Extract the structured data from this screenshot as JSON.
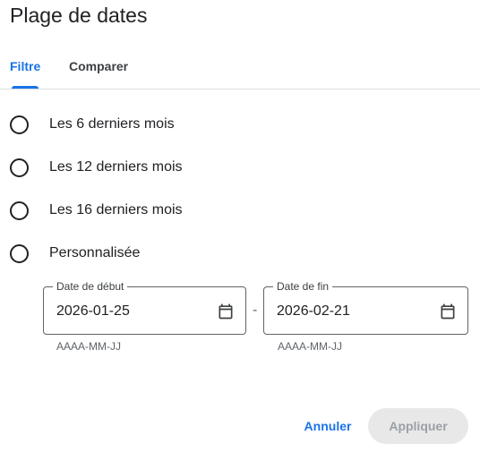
{
  "dialog": {
    "title": "Plage de dates"
  },
  "tabs": [
    {
      "label": "Filtre",
      "active": true
    },
    {
      "label": "Comparer",
      "active": false
    }
  ],
  "options": [
    {
      "label": "Les 6 derniers mois",
      "selected": false
    },
    {
      "label": "Les 12 derniers mois",
      "selected": false
    },
    {
      "label": "Les 16 derniers mois",
      "selected": false
    },
    {
      "label": "Personnalisée",
      "selected": false
    }
  ],
  "start_date": {
    "label": "Date de début",
    "value": "2026-01-25",
    "helper": "AAAA-MM-JJ",
    "icon": "calendar-icon"
  },
  "end_date": {
    "label": "Date de fin",
    "value": "2026-02-21",
    "helper": "AAAA-MM-JJ",
    "icon": "calendar-icon"
  },
  "separator": "-",
  "actions": {
    "cancel_label": "Annuler",
    "apply_label": "Appliquer",
    "apply_enabled": false
  },
  "colors": {
    "accent": "#1a73e8",
    "disabled_bg": "#e8e8e8",
    "disabled_text": "#9aa0a6"
  }
}
